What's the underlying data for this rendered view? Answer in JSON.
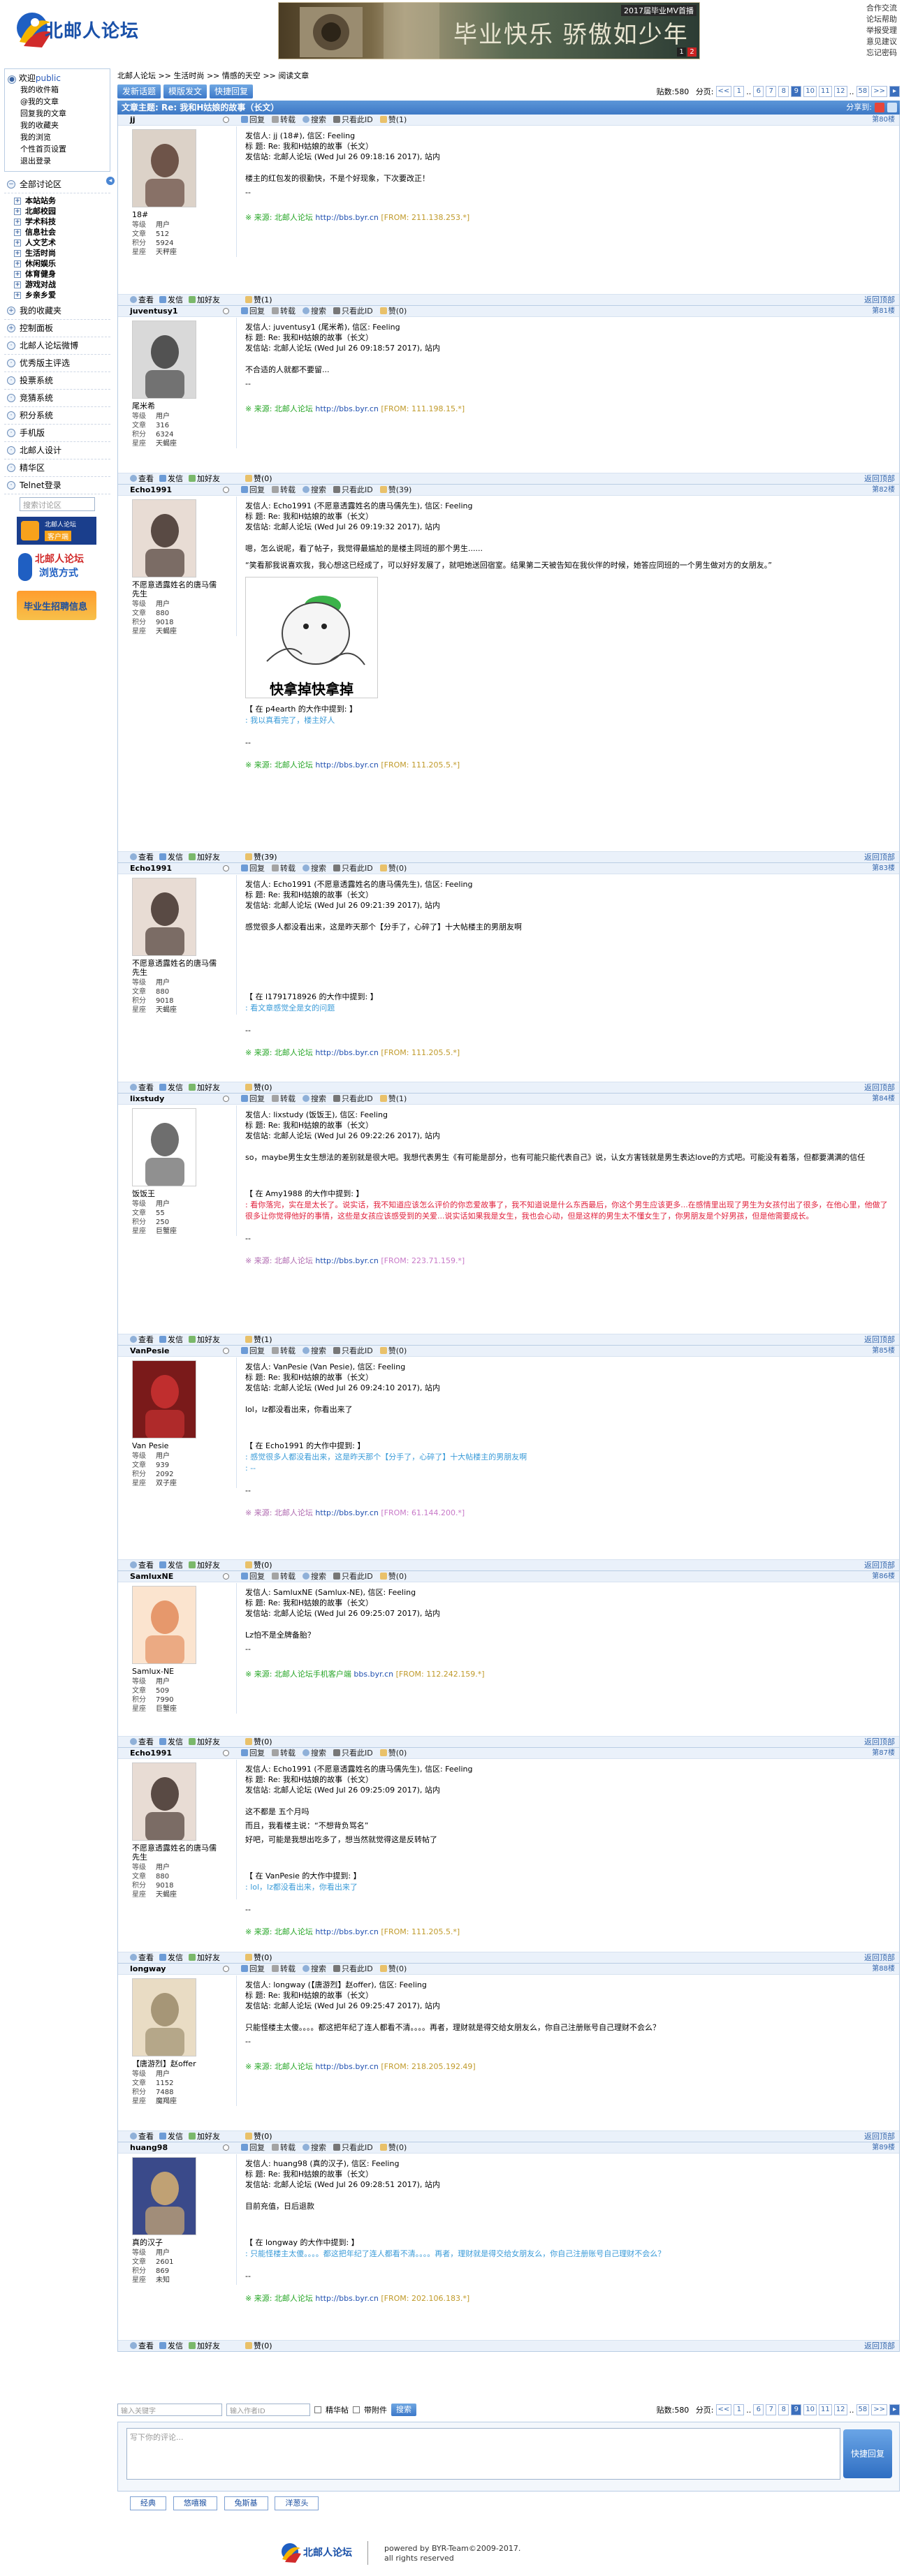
{
  "header": {
    "logo_text": "北邮人论坛",
    "banner_text": "毕业快乐 骄傲如少年",
    "banner_caption": "2017届毕业MV首播",
    "banner_pages": [
      "1",
      "2"
    ],
    "top_links": [
      "合作交流",
      "论坛帮助",
      "举报受理",
      "意见建议",
      "忘记密码"
    ]
  },
  "sidebar": {
    "welcome": "欢迎",
    "username": "public",
    "user_links": [
      "我的收件箱",
      "@我的文章",
      "回复我的文章",
      "我的收藏夹",
      "我的浏览",
      "个性首页设置",
      "退出登录"
    ],
    "section_title": "全部讨论区",
    "sections": [
      "本站站务",
      "北邮校园",
      "学术科技",
      "信息社会",
      "人文艺术",
      "生活时尚",
      "休闲娱乐",
      "体育健身",
      "游戏对战",
      "乡亲乡爱"
    ],
    "menus": [
      "我的收藏夹",
      "控制面板",
      "北邮人论坛微博",
      "优秀版主评选",
      "投票系统",
      "竞猜系统",
      "积分系统",
      "手机版",
      "北邮人设计",
      "精华区",
      "Telnet登录"
    ],
    "search_placeholder": "搜索讨论区",
    "promo1_title": "北邮人论坛",
    "promo1_sub": "客户端",
    "promo2_title": "北邮人论坛",
    "promo2_sub": "浏览方式",
    "promo3_text": "毕业生招聘信息"
  },
  "breadcrumb": [
    "北邮人论坛",
    ">>",
    "生活时尚",
    ">>",
    "情感的天空",
    ">>",
    "阅读文章"
  ],
  "toolbar": {
    "new_post": "发新话题",
    "template_post": "模版发文",
    "quick_reply": "快捷回复"
  },
  "pager": {
    "posts_label": "贴数:580",
    "pages_label": "分页:",
    "prev": "<<",
    "next": ">>",
    "pages": [
      "1",
      "..",
      "6",
      "7",
      "8",
      "9",
      "10",
      "11",
      "12",
      "..",
      "58"
    ],
    "current": "9"
  },
  "topic": {
    "title": "文章主题: Re: 我和H姑娘的故事（长文）",
    "share_label": "分享到:"
  },
  "action_labels": {
    "reply": "回复",
    "forward": "转载",
    "search": "搜索",
    "same_author": "只看此ID",
    "like": "赞",
    "view": "查看",
    "message": "发信",
    "friend": "加好友",
    "back_top": "返回顶部"
  },
  "stat_labels": {
    "level": "等级",
    "posts": "文章",
    "score": "积分",
    "star": "星座"
  },
  "posts": [
    {
      "user": "jj",
      "floor": "第80楼",
      "likes": "(1)",
      "display_name": "18#",
      "level": "用户",
      "posts": "512",
      "score": "5924",
      "star": "天秤座",
      "header": [
        "发信人: jj (18#), 信区: Feeling",
        "标 题: Re: 我和H姑娘的故事（长文）",
        "发信站: 北邮人论坛 (Wed Jul 26 09:18:16 2017), 站内"
      ],
      "body": [
        "楼主的红包发的很勤快，不是个好现象，下次要改正！",
        "--"
      ],
      "quote": [],
      "source_label": "※ 来源: 北邮人论坛",
      "source_url": "http://bbs.byr.cn",
      "source_ip": "[FROM: 211.138.253.*]"
    },
    {
      "user": "juventusy1",
      "floor": "第81楼",
      "likes": "(0)",
      "display_name": "尾米希",
      "level": "用户",
      "posts": "316",
      "score": "6324",
      "star": "天蝎座",
      "header": [
        "发信人: juventusy1 (尾米希), 信区: Feeling",
        "标 题: Re: 我和H姑娘的故事（长文）",
        "发信站: 北邮人论坛 (Wed Jul 26 09:18:57 2017), 站内"
      ],
      "body": [
        "不合适的人就都不要留...",
        "--"
      ],
      "quote": [],
      "source_label": "※ 来源: 北邮人论坛",
      "source_url": "http://bbs.byr.cn",
      "source_ip": "[FROM: 111.198.15.*]"
    },
    {
      "user": "Echo1991",
      "floor": "第82楼",
      "likes": "(39)",
      "display_name": "不愿意透露姓名的唐马儒先生",
      "level": "用户",
      "posts": "880",
      "score": "9018",
      "star": "天蝎座",
      "header": [
        "发信人: Echo1991 (不愿意透露姓名的唐马儒先生), 信区: Feeling",
        "标 题: Re: 我和H姑娘的故事（长文）",
        "发信站: 北邮人论坛 (Wed Jul 26 09:19:32 2017), 站内"
      ],
      "body": [
        "嗯，怎么说呢，看了帖子，我觉得最尴尬的是楼主同班的那个男生......",
        "“笑看那我说喜欢我，我心想这已经成了，可以好好发展了，就吧她送回宿室。结果第二天被告知在我伙伴的时候，她答应同班的一个男生做对方的女朋友。”"
      ],
      "meme_text": "快拿掉快拿掉",
      "quote_head": "【 在 p4earth 的大作中提到: 】",
      "quote": [
        ": 我以真看完了，楼主好人"
      ],
      "source_label": "※ 来源: 北邮人论坛",
      "source_url": "http://bbs.byr.cn",
      "source_ip": "[FROM: 111.205.5.*]"
    },
    {
      "user": "Echo1991",
      "floor": "第83楼",
      "likes": "(0)",
      "display_name": "不愿意透露姓名的唐马儒先生",
      "level": "用户",
      "posts": "880",
      "score": "9018",
      "star": "天蝎座",
      "header": [
        "发信人: Echo1991 (不愿意透露姓名的唐马儒先生), 信区: Feeling",
        "标 题: Re: 我和H姑娘的故事（长文）",
        "发信站: 北邮人论坛 (Wed Jul 26 09:21:39 2017), 站内"
      ],
      "body": [
        "感觉很多人都没看出来，这是昨天那个【分手了，心碎了】十大帖楼主的男朋友啊"
      ],
      "quote_head": "【 在 l1791718926 的大作中提到: 】",
      "quote": [
        ": 看文章感觉全是女的问题"
      ],
      "source_label": "※ 来源: 北邮人论坛",
      "source_url": "http://bbs.byr.cn",
      "source_ip": "[FROM: 111.205.5.*]"
    },
    {
      "user": "lixstudy",
      "floor": "第84楼",
      "likes": "(1)",
      "display_name": "饭饭王",
      "level": "用户",
      "posts": "55",
      "score": "250",
      "star": "巨蟹座",
      "header": [
        "发信人: lixstudy (饭饭王), 信区: Feeling",
        "标 题: Re: 我和H姑娘的故事（长文）",
        "发信站: 北邮人论坛 (Wed Jul 26 09:22:26 2017), 站内"
      ],
      "body": [
        "so，maybe男生女生想法的差别就是很大吧。我想代表男生《有可能是部分，也有可能只能代表自己》说，认女方害钱就是男生表达love的方式吧。可能没有着落，但都要满满的信任"
      ],
      "quote_head": "【 在 Amy1988 的大作中提到: 】",
      "quote": [
        ": 看你落完，实在是太长了。说实话，我不知道应该怎么评价的你恋爱故事了，我不知道说是什么东西最后，你这个男生应该更多...在感情里出现了男生为女孩付出了很多，在他心里，他做了很多让你觉得他好的事情，这些是女孩应该感受到的关爱...说实话如果我是女生，我也会心动，但是这样的男生太不懂女生了，你男朋友是个好男孩，但是他需要成长。"
      ],
      "source_label": "※ 来源: 北邮人论坛",
      "source_url": "http://bbs.byr.cn",
      "source_ip": "[FROM: 223.71.159.*]",
      "purple": true
    },
    {
      "user": "VanPesie",
      "floor": "第85楼",
      "likes": "(0)",
      "display_name": "Van Pesie",
      "level": "用户",
      "posts": "939",
      "score": "2092",
      "star": "双子座",
      "header": [
        "发信人: VanPesie (Van Pesie), 信区: Feeling",
        "标 题: Re: 我和H姑娘的故事（长文）",
        "发信站: 北邮人论坛 (Wed Jul 26 09:24:10 2017), 站内"
      ],
      "body": [
        "lol，lz都没看出来，你看出来了"
      ],
      "quote_head": "【 在 Echo1991 的大作中提到: 】",
      "quote": [
        ": 感觉很多人都没看出来，这是昨天那个【分手了，心碎了】十大帖楼主的男朋友啊",
        ": --"
      ],
      "source_label": "※ 来源: 北邮人论坛",
      "source_url": "http://bbs.byr.cn",
      "source_ip": "[FROM: 61.144.200.*]",
      "purple": true
    },
    {
      "user": "SamluxNE",
      "floor": "第86楼",
      "likes": "(0)",
      "display_name": "Samlux-NE",
      "level": "用户",
      "posts": "509",
      "score": "7990",
      "star": "巨蟹座",
      "header": [
        "发信人: SamluxNE (Samlux-NE), 信区: Feeling",
        "标 题: Re: 我和H姑娘的故事（长文）",
        "发信站: 北邮人论坛 (Wed Jul 26 09:25:07 2017), 站内"
      ],
      "body": [
        "Lz怕不是全牌备胎？",
        "--"
      ],
      "quote": [],
      "source_label": "※ 来源: 北邮人论坛手机客户端",
      "source_url": "bbs.byr.cn",
      "source_ip": "[FROM: 112.242.159.*]"
    },
    {
      "user": "Echo1991",
      "floor": "第87楼",
      "likes": "(0)",
      "display_name": "不愿意透露姓名的唐马儒先生",
      "level": "用户",
      "posts": "880",
      "score": "9018",
      "star": "天蝎座",
      "header": [
        "发信人: Echo1991 (不愿意透露姓名的唐马儒先生), 信区: Feeling",
        "标 题: Re: 我和H姑娘的故事（长文）",
        "发信站: 北邮人论坛 (Wed Jul 26 09:25:09 2017), 站内"
      ],
      "body": [
        "这不都是 五个月吗",
        "而且，我看楼主说：“不想背负骂名”",
        "好吧，可能是我想出吃多了，想当然就觉得这是反转帖了"
      ],
      "quote_head": "【 在 VanPesie 的大作中提到: 】",
      "quote": [
        ": lol，lz都没看出来，你看出来了"
      ],
      "source_label": "※ 来源: 北邮人论坛",
      "source_url": "http://bbs.byr.cn",
      "source_ip": "[FROM: 111.205.5.*]"
    },
    {
      "user": "longway",
      "floor": "第88楼",
      "likes": "(0)",
      "display_name": "【唐游烈】赵offer",
      "level": "用户",
      "posts": "1152",
      "score": "7488",
      "star": "魔羯座",
      "header": [
        "发信人: longway (【唐游烈】赵offer), 信区: Feeling",
        "标 题: Re: 我和H姑娘的故事（长文）",
        "发信站: 北邮人论坛 (Wed Jul 26 09:25:47 2017), 站内"
      ],
      "body": [
        "只能怪楼主太傻。。。。都这把年纪了连人都看不清。。。。再者，理财就是得交给女朋友么，你自己注册账号自己理财不会么？",
        "--"
      ],
      "quote": [],
      "source_label": "※ 来源: 北邮人论坛",
      "source_url": "http://bbs.byr.cn",
      "source_ip": "[FROM: 218.205.192.49]"
    },
    {
      "user": "huang98",
      "floor": "第89楼",
      "likes": "(0)",
      "display_name": "真的汉子",
      "level": "用户",
      "posts": "2601",
      "score": "869",
      "star": "未知",
      "header": [
        "发信人: huang98 (真的汉子), 信区: Feeling",
        "标 题: Re: 我和H姑娘的故事（长文）",
        "发信站: 北邮人论坛 (Wed Jul 26 09:28:51 2017), 站内"
      ],
      "body": [
        "目前充值，日后退款"
      ],
      "quote_head": "【 在 longway 的大作中提到: 】",
      "quote": [
        ": 只能怪楼主太傻。。。。都这把年纪了连人都看不清。。。。再者，理财就是得交给女朋友么，你自己注册账号自己理财不会么？"
      ],
      "source_label": "※ 来源: 北邮人论坛",
      "source_url": "http://bbs.byr.cn",
      "source_ip": "[FROM: 202.106.183.*]"
    }
  ],
  "bottom": {
    "keyword_placeholder": "输入关键字",
    "author_placeholder": "输入作者ID",
    "opt1": "精华帖",
    "opt2": "带附件",
    "search_btn": "搜索",
    "reply_placeholder": "写下你的评论...",
    "quick_reply_btn": "快捷回复",
    "emoji_tabs": [
      "经典",
      "悠嘻猴",
      "兔斯基",
      "洋葱头"
    ]
  },
  "footer": {
    "logo_text": "北邮人论坛",
    "powered": "powered by BYR-Team©2009-2017.",
    "rights": "all rights reserved"
  }
}
